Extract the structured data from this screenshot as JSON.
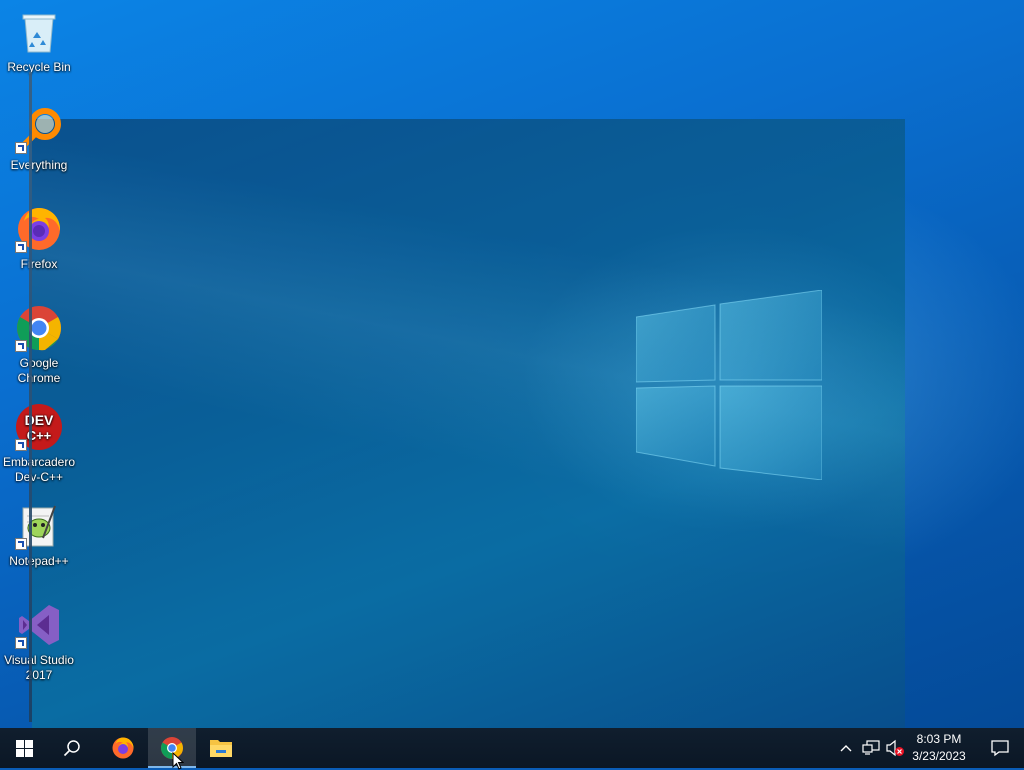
{
  "desktop": {
    "icons": [
      {
        "label": "Recycle Bin",
        "icon": "recycle-bin-icon"
      },
      {
        "label": "Everything",
        "icon": "everything-search-icon"
      },
      {
        "label": "Firefox",
        "icon": "firefox-icon"
      },
      {
        "label": "Google Chrome",
        "icon": "chrome-icon"
      },
      {
        "label": "Embarcadero Dev-C++",
        "icon": "devcpp-icon",
        "icon_text_top": "DEV",
        "icon_text_bottom": "C++"
      },
      {
        "label": "Notepad++",
        "icon": "notepadpp-icon"
      },
      {
        "label": "Visual Studio 2017",
        "icon": "visual-studio-icon"
      }
    ]
  },
  "taskbar": {
    "buttons": [
      {
        "name": "start",
        "icon": "windows-start-icon"
      },
      {
        "name": "search",
        "icon": "search-icon"
      },
      {
        "name": "firefox",
        "icon": "firefox-icon"
      },
      {
        "name": "chrome",
        "icon": "chrome-icon",
        "state": "active"
      },
      {
        "name": "file-explorer",
        "icon": "folder-icon"
      }
    ],
    "tray": {
      "icons": [
        "chevron-up-icon",
        "network-icon",
        "volume-muted-icon"
      ],
      "time": "8:03 PM",
      "date": "3/23/2023",
      "notification_icon": "action-center-icon"
    }
  },
  "colors": {
    "desktop_blue": "#0a6fd0",
    "taskbar": "#0c1a2a",
    "accent": "#7fb7ea"
  }
}
